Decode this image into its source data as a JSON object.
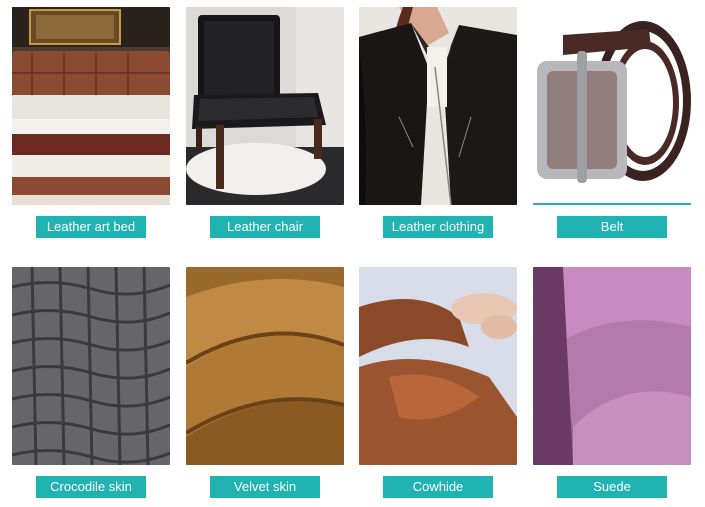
{
  "products": [
    {
      "label": "Leather art bed",
      "icon": "leather-bed-image"
    },
    {
      "label": "Leather chair",
      "icon": "leather-chair-image"
    },
    {
      "label": "Leather clothing",
      "icon": "leather-jacket-image"
    },
    {
      "label": "Belt",
      "icon": "leather-belt-image"
    },
    {
      "label": "Crocodile skin",
      "icon": "crocodile-skin-image"
    },
    {
      "label": "Velvet skin",
      "icon": "velvet-skin-image"
    },
    {
      "label": "Cowhide",
      "icon": "cowhide-image"
    },
    {
      "label": "Suede",
      "icon": "suede-image"
    }
  ],
  "colors": {
    "label_background": "#21b2b2",
    "label_text": "#ffffff"
  }
}
